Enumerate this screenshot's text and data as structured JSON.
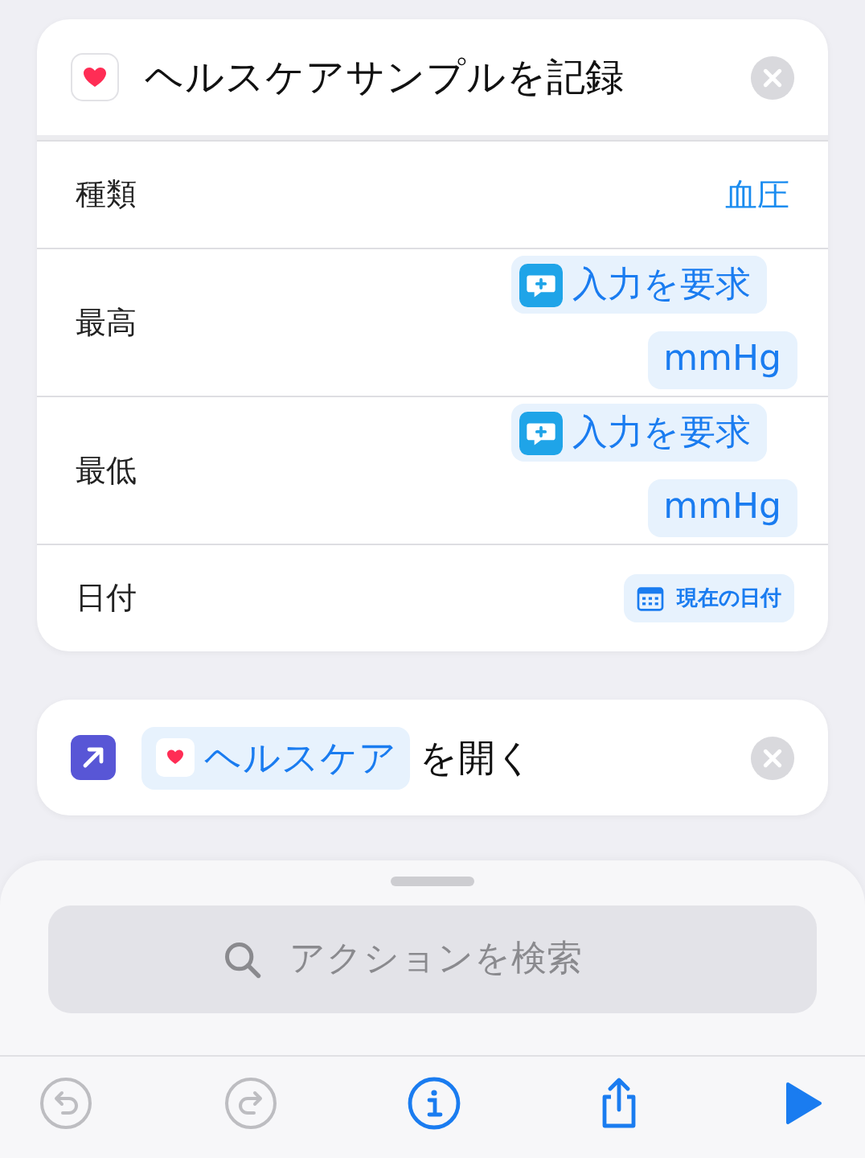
{
  "action_card": {
    "title": "ヘルスケアサンプルを記録",
    "rows": [
      {
        "label": "種類",
        "tokens": [
          {
            "kind": "plain",
            "text": "血圧"
          }
        ]
      },
      {
        "label": "最高",
        "tokens": [
          {
            "kind": "ask",
            "text": "入力を要求"
          },
          {
            "kind": "pill",
            "text": "mmHg"
          }
        ]
      },
      {
        "label": "最低",
        "tokens": [
          {
            "kind": "ask",
            "text": "入力を要求"
          },
          {
            "kind": "pill",
            "text": "mmHg"
          }
        ]
      },
      {
        "label": "日付",
        "tokens": [
          {
            "kind": "date",
            "text": "現在の日付"
          }
        ]
      }
    ]
  },
  "open_card": {
    "app": "ヘルスケア",
    "suffix": "を開く"
  },
  "search": {
    "placeholder": "アクションを検索"
  },
  "toolbar": [
    {
      "kind": "undo",
      "disabled": true
    },
    {
      "kind": "redo",
      "disabled": true
    },
    {
      "kind": "info",
      "disabled": false
    },
    {
      "kind": "share",
      "disabled": false
    },
    {
      "kind": "run",
      "disabled": false
    }
  ]
}
